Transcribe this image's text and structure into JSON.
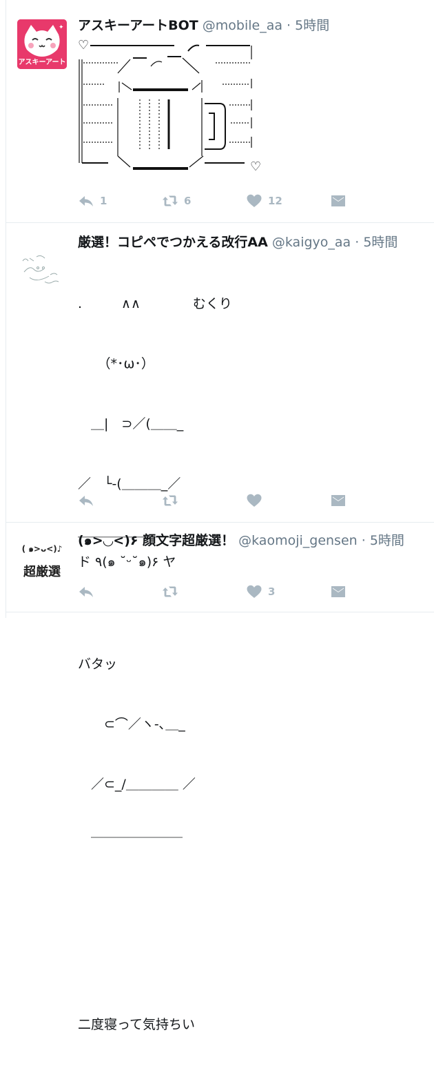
{
  "tweets": [
    {
      "name": "アスキーアートBOT",
      "handle": "@mobile_aa",
      "time": "5時間",
      "avatar_text": "アスキーアート",
      "heart_glyph": "♡",
      "actions": {
        "reply": "1",
        "retweet": "6",
        "like": "12"
      }
    },
    {
      "name": "厳選！コピペでつかえる改行AA",
      "handle": "@kaigyo_aa",
      "time": "5時間",
      "lines": [
        ".　　　∧∧　　　　むくり",
        "　　（*･ω･）",
        "　＿|　⊃／(＿＿_",
        "／　└-(＿＿＿_／",
        "￣￣￣￣￣￣￣",
        "",
        "バタッ",
        "　　⊂⌒／ヽ-､＿_",
        "　／⊂_/＿＿＿＿ ／",
        "　￣￣￣￣￣￣￣",
        "",
        "",
        "二度寝って気持ちい"
      ],
      "actions": {
        "reply": "",
        "retweet": "",
        "like": ""
      }
    },
    {
      "name": "(๑>◡<)۶ 顔文字超厳選！",
      "handle": "@kaomoji_gensen",
      "time": "5時間",
      "avatar_top": "( ๑>ᴗ<)♪",
      "avatar_text": "超厳選",
      "line": "ド ٩(๑ ˘ᵕ˘๑)۶ ヤ",
      "actions": {
        "reply": "",
        "retweet": "",
        "like": "3"
      }
    }
  ]
}
